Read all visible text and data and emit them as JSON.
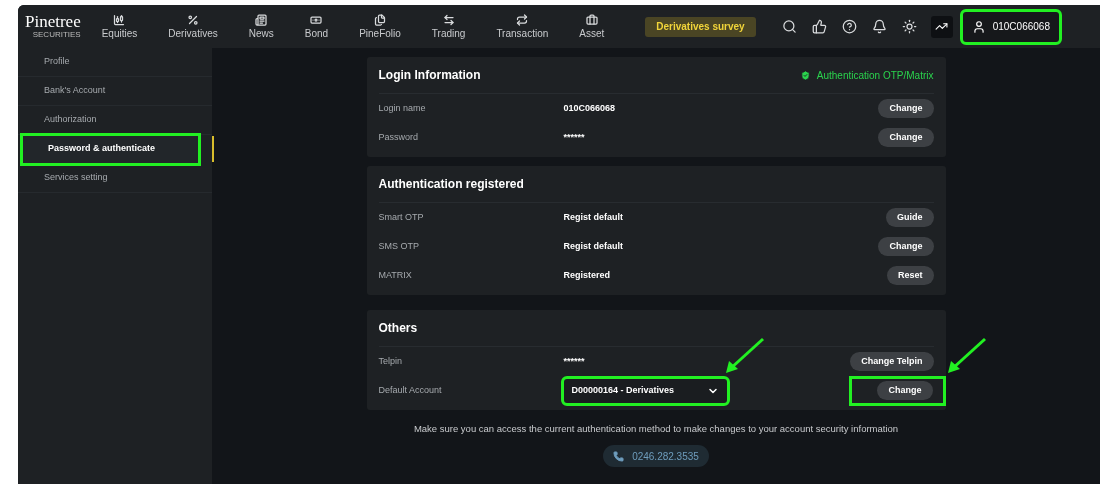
{
  "header": {
    "logo": "Pinetree",
    "logo_sub": "SECURITIES",
    "nav": [
      {
        "label": "Equities"
      },
      {
        "label": "Derivatives"
      },
      {
        "label": "News"
      },
      {
        "label": "Bond"
      },
      {
        "label": "PineFolio"
      },
      {
        "label": "Trading"
      },
      {
        "label": "Transaction"
      },
      {
        "label": "Asset"
      }
    ],
    "survey_button": "Derivatives survey",
    "account": {
      "label": "010C066068",
      "highlighted": true
    }
  },
  "sidebar": {
    "items": [
      {
        "label": "Profile",
        "selected": false,
        "highlighted": false
      },
      {
        "label": "Bank's Account",
        "selected": false,
        "highlighted": false
      },
      {
        "label": "Authorization",
        "selected": false,
        "highlighted": false
      },
      {
        "label": "Password & authenticate",
        "selected": true,
        "highlighted": true
      },
      {
        "label": "Services setting",
        "selected": false,
        "highlighted": false
      }
    ]
  },
  "sections": [
    {
      "title": "Login Information",
      "badge": "Authentication OTP/Matrix",
      "rows": [
        {
          "label": "Login name",
          "kind": "text",
          "value": "010C066068",
          "button": "Change",
          "highlighted": false
        },
        {
          "label": "Password",
          "kind": "text",
          "value": "******",
          "button": "Change",
          "highlighted": false
        }
      ]
    },
    {
      "title": "Authentication registered",
      "rows": [
        {
          "label": "Smart OTP",
          "kind": "text",
          "value": "Regist default",
          "button": "Guide",
          "highlighted": false
        },
        {
          "label": "SMS OTP",
          "kind": "text",
          "value": "Regist default",
          "button": "Change",
          "highlighted": false
        },
        {
          "label": "MATRIX",
          "kind": "text",
          "value": "Registered",
          "button": "Reset",
          "highlighted": false
        }
      ]
    },
    {
      "title": "Others",
      "rows": [
        {
          "label": "Telpin",
          "kind": "text",
          "value": "******",
          "button": "Change Telpin",
          "highlighted": false
        },
        {
          "label": "Default Account",
          "kind": "select",
          "value": "D00000164 - Derivatives",
          "button": "Change",
          "highlighted": true
        }
      ]
    }
  ],
  "note": "Make sure you can access the current authentication method to make changes to your account security information",
  "phone": "0246.282.3535"
}
